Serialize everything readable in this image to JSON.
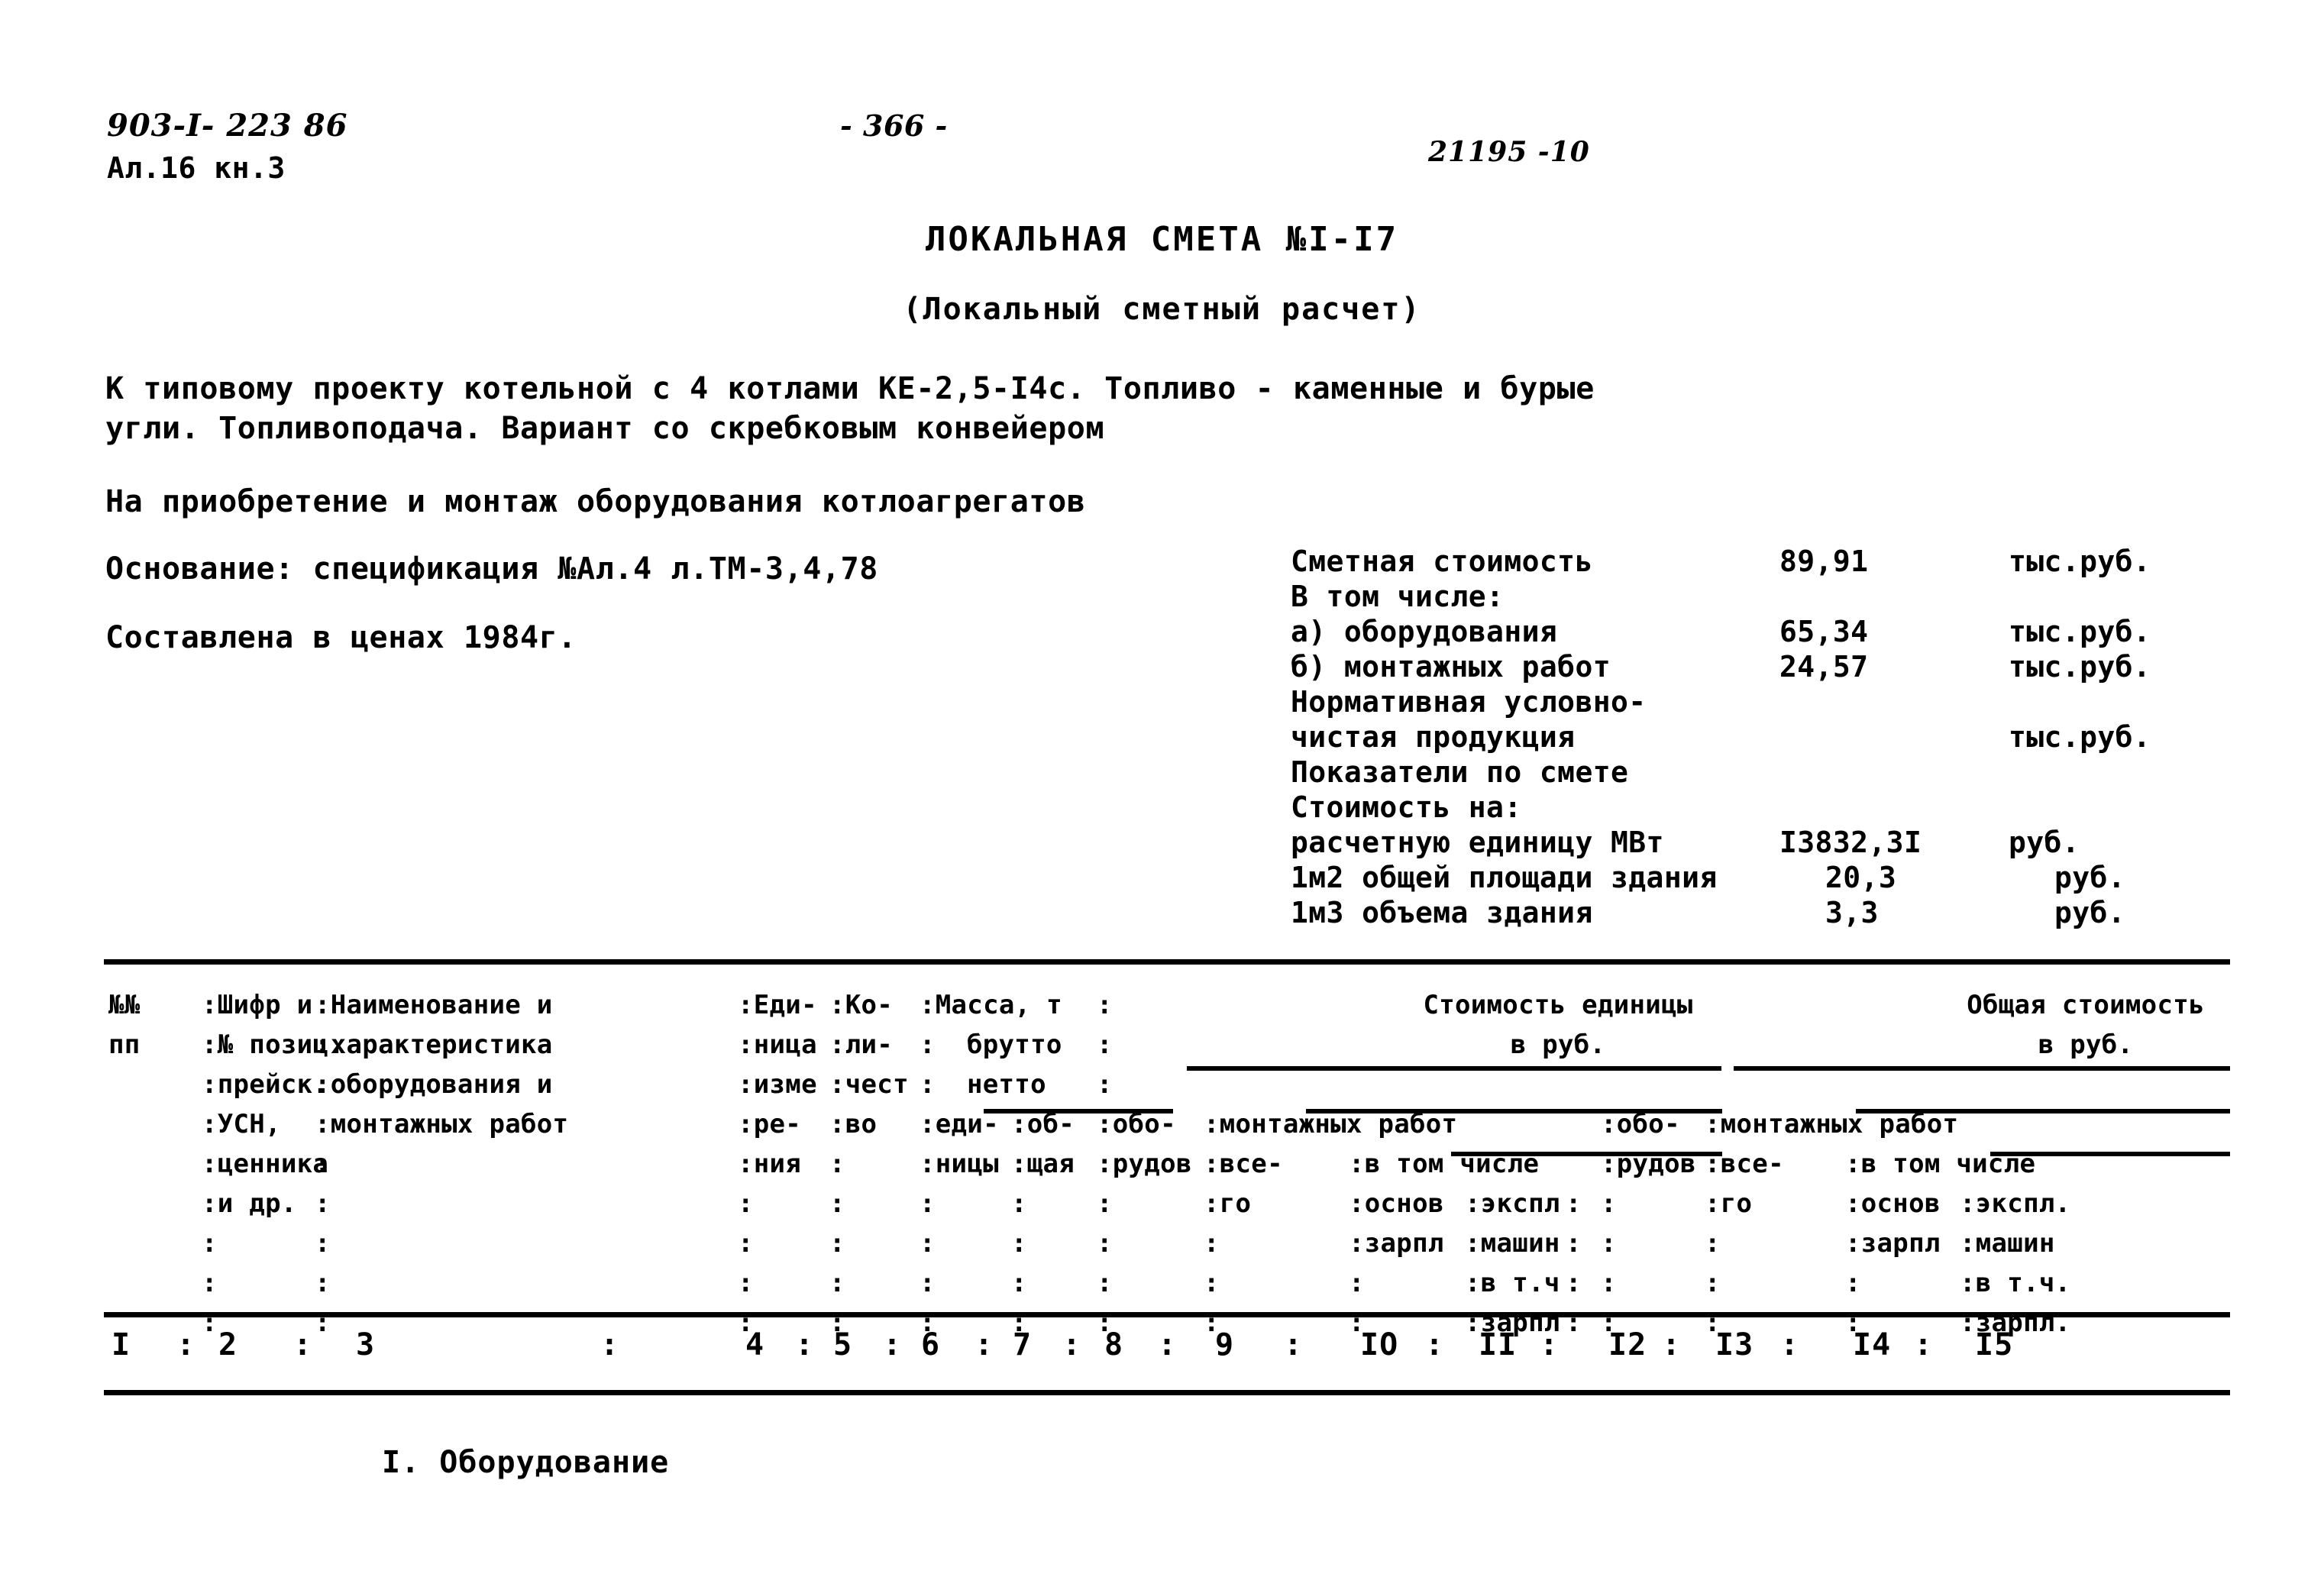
{
  "header": {
    "doc_code": "903-I- 223 86",
    "album_code": "Ал.16 кн.3",
    "page_number": "- 366 -",
    "order_number": "21195 -10"
  },
  "titles": {
    "main": "ЛОКАЛЬНАЯ СМЕТА №I-I7",
    "sub": "(Локальный сметный расчет)"
  },
  "description": {
    "line1": "К типовому проекту котельной с 4 котлами КЕ-2,5-I4с. Топливо - каменные и бурые",
    "line2": "угли. Топливоподача. Вариант со скребковым конвейером",
    "line3": "На приобретение и монтаж оборудования котлоагрегатов",
    "basis": "Основание: спецификация №Ал.4 л.ТМ-3,4,78",
    "prices": "Составлена в ценах 1984г."
  },
  "summary": {
    "rows": [
      {
        "label": "Сметная стоимость",
        "value": "89,91",
        "unit": "тыс.руб."
      },
      {
        "label": "В том числе:",
        "value": "",
        "unit": ""
      },
      {
        "label": "а) оборудования",
        "value": "65,34",
        "unit": "тыс.руб."
      },
      {
        "label": "б) монтажных работ",
        "value": "24,57",
        "unit": "тыс.руб."
      },
      {
        "label": "Нормативная условно-",
        "value": "",
        "unit": ""
      },
      {
        "label": "чистая продукция",
        "value": "",
        "unit": "тыс.руб."
      },
      {
        "label": "Показатели по смете",
        "value": "",
        "unit": ""
      },
      {
        "label": "Стоимость на:",
        "value": "",
        "unit": ""
      },
      {
        "label": "расчетную единицу МВт",
        "value": "I3832,3I",
        "unit": "руб."
      },
      {
        "label": "1м2 общей площади здания",
        "value": "20,3",
        "unit": "руб."
      },
      {
        "label": "1м3 объема здания",
        "value": "3,3",
        "unit": "руб."
      }
    ]
  },
  "table": {
    "header_cells": {
      "c1_l1": "№№",
      "c1_l2": "пп",
      "c2_l1": ":Шифр и",
      "c2_l2": ":№ позиц.",
      "c2_l3": ":прейск.",
      "c2_l4": ":УСН,",
      "c2_l5": ":ценника",
      "c2_l6": ":и др.",
      "c2_l7": ":",
      "c2_l8": ":",
      "c2_l9": ":",
      "c3_l1": ":Наименование и",
      "c3_l2": ":характеристика",
      "c3_l3": ":оборудования и",
      "c3_l4": ":монтажных работ",
      "c3_dots": ":",
      "c4_l1": ":Еди-",
      "c4_l2": ":ница",
      "c4_l3": ":изме",
      "c4_l4": ":ре-",
      "c4_l5": ":ния",
      "c5_l1": ":Ко-",
      "c5_l2": ":ли-",
      "c5_l3": ":чест",
      "c5_l4": ":во",
      "c67_title": ":Масса, т",
      "c67_brutto": "брутто",
      "c67_netto": "нетто",
      "c6_l1": ":еди-",
      "c6_l2": ":ницы",
      "c7_l1": ":об-",
      "c7_l2": ":щая",
      "g1_title": "Стоимость единицы",
      "g1_sub": "в руб.",
      "g2_title": "Общая стоимость",
      "g2_sub": "в руб.",
      "c8_l1": ":обо-",
      "c8_l2": ":рудов",
      "c910_span": ":монтажных работ",
      "c9_l1": ":все-",
      "c9_l2": ":го",
      "c10_span": ":в том числе",
      "c10_l1": ":основ",
      "c10_l2": ":зарпл",
      "c10b_l1": ":экспл",
      "c10b_l2": ":машин",
      "c10b_l3": ":в т.ч",
      "c10b_l4": ":зарпл",
      "c11_l1": ":обо-",
      "c11_l2": ":рудов",
      "c1314_span": ":монтажных работ",
      "c13_l1": ":все-",
      "c13_l2": ":го",
      "c14_span": ":в том числе",
      "c14_l1": ":основ",
      "c14_l2": ":зарпл",
      "c15_l1": ":экспл.",
      "c15_l2": ":машин",
      "c15_l3": ":в т.ч.",
      "c15_l4": ":зарпл.",
      "colon": ":"
    },
    "column_numbers": [
      "I",
      "2",
      "3",
      "4",
      "5",
      "6",
      "7",
      "8",
      "9",
      "IO",
      "II",
      "I2",
      "I3",
      "I4",
      "I5"
    ],
    "column_separator": ":"
  },
  "section": {
    "heading": "I. Оборудование"
  }
}
